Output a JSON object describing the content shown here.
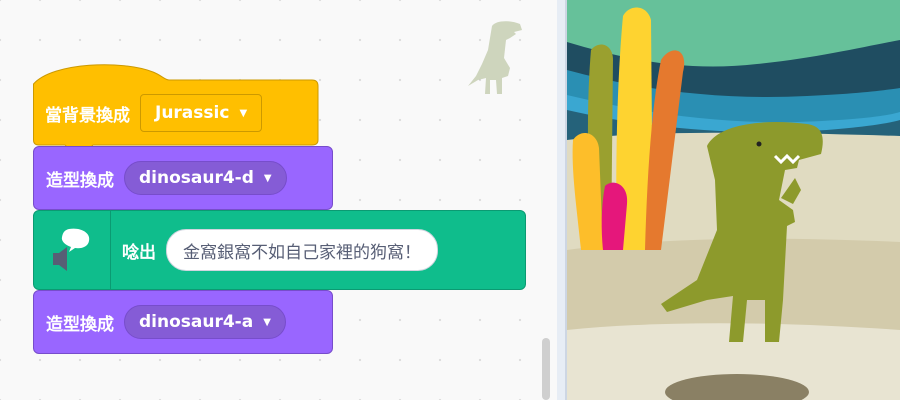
{
  "blocks": {
    "backdrop_hat": {
      "label": "當背景換成",
      "dropdown": "Jurassic"
    },
    "switch_costume_1": {
      "label": "造型換成",
      "dropdown": "dinosaur4-d"
    },
    "speak": {
      "label": "唸出",
      "text": "金窩銀窩不如自己家裡的狗窩！"
    },
    "switch_costume_2": {
      "label": "造型換成",
      "dropdown": "dinosaur4-a"
    }
  },
  "icons": {
    "dropdown_arrow": "▼",
    "speech_bubble": "speech-bubble-icon",
    "speaker": "speaker-icon"
  },
  "colors": {
    "events": "#ffbf00",
    "looks": "#9966ff",
    "text_to_speech": "#0fbd8c"
  }
}
